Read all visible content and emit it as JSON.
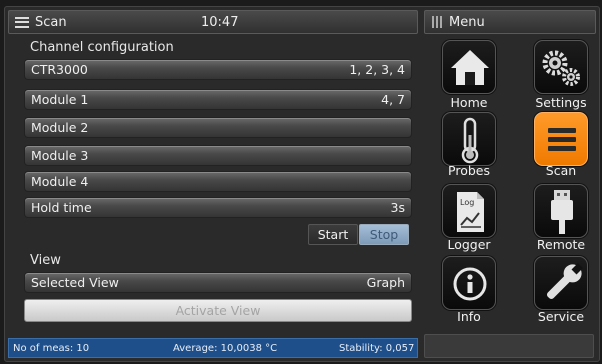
{
  "header": {
    "title": "Scan",
    "time": "10:47",
    "menu_title": "Menu"
  },
  "channel_config": {
    "label": "Channel configuration",
    "rows": [
      {
        "name": "CTR3000",
        "value": "1, 2, 3, 4"
      },
      {
        "name": "Module 1",
        "value": "4, 7"
      },
      {
        "name": "Module 2",
        "value": ""
      },
      {
        "name": "Module 3",
        "value": ""
      },
      {
        "name": "Module 4",
        "value": ""
      },
      {
        "name": "Hold time",
        "value": "3s"
      }
    ]
  },
  "controls": {
    "start_label": "Start",
    "stop_label": "Stop"
  },
  "view": {
    "label": "View",
    "selected_label": "Selected View",
    "selected_value": "Graph",
    "activate_label": "Activate View"
  },
  "status": {
    "meas": "No of meas: 10",
    "average": "Average: 10,0038 °C",
    "stability": "Stability: 0,057"
  },
  "menu": {
    "items": [
      {
        "label": "Home",
        "icon": "home-icon"
      },
      {
        "label": "Settings",
        "icon": "gears-icon"
      },
      {
        "label": "Probes",
        "icon": "thermometer-icon"
      },
      {
        "label": "Scan",
        "icon": "scan-list-icon",
        "active": true
      },
      {
        "label": "Logger",
        "icon": "log-document-icon",
        "icon_text": "Log"
      },
      {
        "label": "Remote",
        "icon": "usb-plug-icon"
      },
      {
        "label": "Info",
        "icon": "info-icon"
      },
      {
        "label": "Service",
        "icon": "wrench-icon"
      }
    ]
  },
  "colors": {
    "accent_active": "#f07a00",
    "status_bar": "#1f4f8a",
    "stop_button": "#8fa9c4"
  }
}
